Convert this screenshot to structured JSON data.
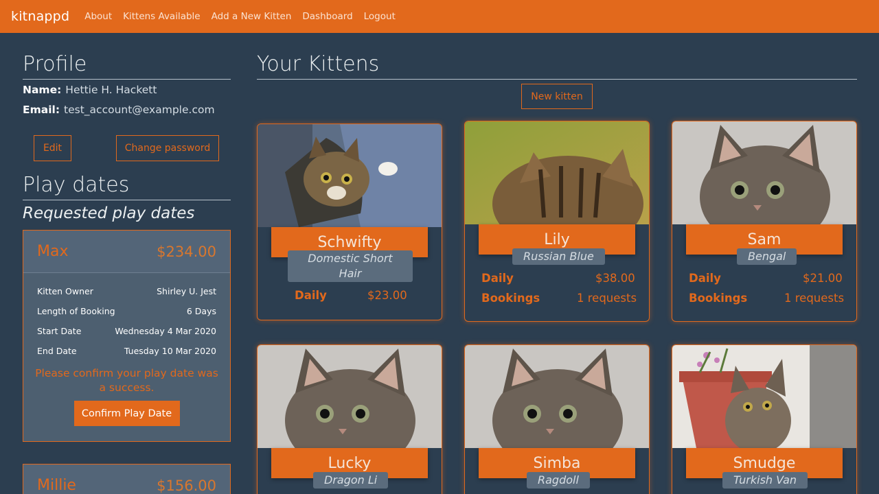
{
  "nav": {
    "brand": "kitnappd",
    "links": [
      "About",
      "Kittens Available",
      "Add a New Kitten",
      "Dashboard",
      "Logout"
    ]
  },
  "profile": {
    "heading": "Profile",
    "name_label": "Name:",
    "name_value": "Hettie H. Hackett",
    "email_label": "Email:",
    "email_value": "test_account@example.com",
    "edit_label": "Edit",
    "change_password_label": "Change password"
  },
  "playdates": {
    "heading": "Play dates",
    "subheading": "Requested play dates",
    "cards": [
      {
        "name": "Max",
        "price": "$234.00",
        "rows": [
          {
            "label": "Kitten Owner",
            "value": "Shirley U. Jest"
          },
          {
            "label": "Length of Booking",
            "value": "6 Days"
          },
          {
            "label": "Start Date",
            "value": "Wednesday 4 Mar 2020"
          },
          {
            "label": "End Date",
            "value": "Tuesday 10 Mar 2020"
          }
        ],
        "message": "Please confirm your play date was a success.",
        "button": "Confirm Play Date"
      },
      {
        "name": "Millie",
        "price": "$156.00"
      }
    ]
  },
  "kittens": {
    "heading": "Your Kittens",
    "new_kitten_label": "New kitten",
    "daily_label": "Daily",
    "bookings_label": "Bookings",
    "cards": [
      {
        "name": "Schwifty",
        "breed": "Domestic Short Hair",
        "daily": "$23.00",
        "bookings": ""
      },
      {
        "name": "Lily",
        "breed": "Russian Blue",
        "daily": "$38.00",
        "bookings": "1 requests"
      },
      {
        "name": "Sam",
        "breed": "Bengal",
        "daily": "$21.00",
        "bookings": "1 requests"
      },
      {
        "name": "Lucky",
        "breed": "Dragon Li"
      },
      {
        "name": "Simba",
        "breed": "Ragdoll"
      },
      {
        "name": "Smudge",
        "breed": "Turkish Van"
      }
    ]
  },
  "colors": {
    "accent": "#e2691c",
    "background": "#2c3e50",
    "card": "#4d5f70"
  }
}
